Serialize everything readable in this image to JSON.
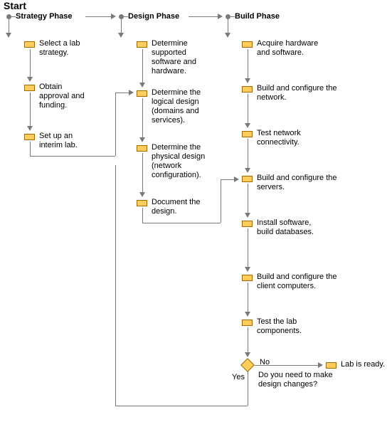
{
  "chart_data": {
    "type": "flowchart",
    "title": "Start",
    "phases": [
      {
        "name": "Strategy Phase",
        "steps": [
          {
            "id": "s1",
            "text": "Select a lab strategy."
          },
          {
            "id": "s2",
            "text": "Obtain approval and funding."
          },
          {
            "id": "s3",
            "text": "Set up an interim lab."
          }
        ]
      },
      {
        "name": "Design Phase",
        "steps": [
          {
            "id": "d1",
            "text": "Determine supported software and hardware."
          },
          {
            "id": "d2",
            "text": "Determine the logical design (domains and services)."
          },
          {
            "id": "d3",
            "text": "Determine the physical design (network configuration)."
          },
          {
            "id": "d4",
            "text": "Document the design."
          }
        ]
      },
      {
        "name": "Build Phase",
        "steps": [
          {
            "id": "b1",
            "text": "Acquire hardware and software."
          },
          {
            "id": "b2",
            "text": "Build and configure the network."
          },
          {
            "id": "b3",
            "text": "Test network connectivity."
          },
          {
            "id": "b4",
            "text": "Build and configure the servers."
          },
          {
            "id": "b5",
            "text": "Install software, build databases."
          },
          {
            "id": "b6",
            "text": "Build and configure the client computers."
          },
          {
            "id": "b7",
            "text": "Test the lab components."
          }
        ],
        "decision": {
          "id": "dec1",
          "question": "Do you need to make design changes?",
          "yes": {
            "label": "Yes",
            "target": "d2"
          },
          "no": {
            "label": "No",
            "target": "end"
          }
        },
        "terminal": {
          "id": "end",
          "text": "Lab is ready."
        }
      }
    ]
  }
}
